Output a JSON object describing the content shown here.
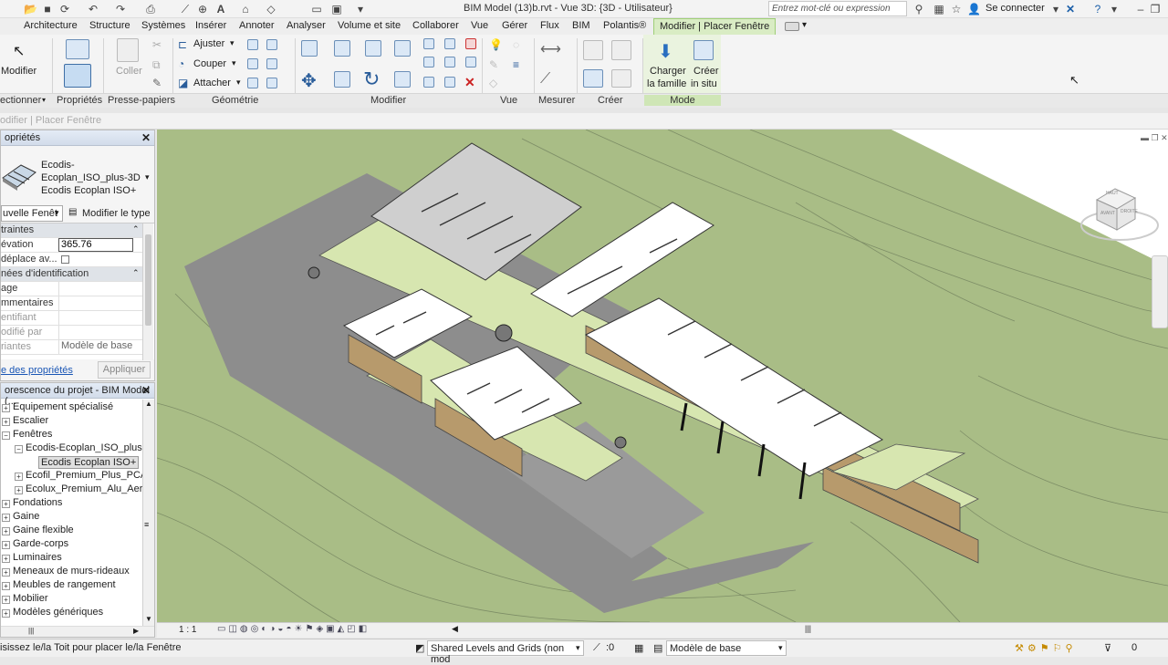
{
  "window": {
    "title": "BIM Model (13)b.rvt - Vue 3D: {3D - Utilisateur}",
    "search_placeholder": "Entrez mot-clé ou expression",
    "sign_in": "Se connecter"
  },
  "ribbon_tabs": [
    "Architecture",
    "Structure",
    "Systèmes",
    "Insérer",
    "Annoter",
    "Analyser",
    "Volume et site",
    "Collaborer",
    "Vue",
    "Gérer",
    "Flux",
    "BIM",
    "Polantis®",
    "Modifier | Placer Fenêtre"
  ],
  "ribbon": {
    "modify_label": "Modifier",
    "paste_label": "Coller",
    "adjust_label": "Ajuster",
    "cut_label": "Couper",
    "attach_label": "Attacher",
    "load_family_line1": "Charger",
    "load_family_line2": "la famille",
    "create_inplace_line1": "Créer",
    "create_inplace_line2": "in situ",
    "groups": {
      "select": "ectionner",
      "properties": "Propriétés",
      "clipboard": "Presse-papiers",
      "geometry": "Géométrie",
      "modify": "Modifier",
      "view": "Vue",
      "measure": "Mesurer",
      "create": "Créer",
      "mode": "Mode"
    }
  },
  "options_bar": "odifier | Placer Fenêtre",
  "properties_panel": {
    "title": "opriétés",
    "type_line1": "Ecodis-",
    "type_line2": "Ecoplan_ISO_plus-3D",
    "type_line3": "Ecodis Ecoplan ISO+",
    "filter_value": "uvelle Fenêt",
    "edit_type": "Modifier le type",
    "rows": [
      {
        "key": "traintes",
        "value": "",
        "section": true
      },
      {
        "key": "évation",
        "value": "365.76",
        "section": false
      },
      {
        "key": "déplace av...",
        "value": "",
        "section": false
      },
      {
        "key": "nées d'identification",
        "value": "",
        "section": true
      },
      {
        "key": "age",
        "value": "",
        "section": false
      },
      {
        "key": "mmentaires",
        "value": "",
        "section": false
      },
      {
        "key": "entifiant",
        "value": "",
        "section": false
      },
      {
        "key": "odifié par",
        "value": "",
        "section": false
      },
      {
        "key": "riantes",
        "value": "Modèle de base",
        "section": false
      }
    ],
    "help_link": "e des propriétés",
    "apply": "Appliquer"
  },
  "browser": {
    "title": "orescence du projet - BIM Model (...",
    "items": [
      {
        "label": "Equipement spécialisé",
        "level": 0,
        "toggle": "+"
      },
      {
        "label": "Escalier",
        "level": 0,
        "toggle": "+"
      },
      {
        "label": "Fenêtres",
        "level": 0,
        "toggle": "−"
      },
      {
        "label": "Ecodis-Ecoplan_ISO_plus-3D",
        "level": 1,
        "toggle": "−"
      },
      {
        "label": "Ecodis Ecoplan ISO+",
        "level": 2,
        "toggle": ""
      },
      {
        "label": "Ecofil_Premium_Plus_PCA_1(",
        "level": 1,
        "toggle": "+"
      },
      {
        "label": "Ecolux_Premium_Alu_Aerati",
        "level": 1,
        "toggle": "+"
      },
      {
        "label": "Fondations",
        "level": 0,
        "toggle": "+"
      },
      {
        "label": "Gaine",
        "level": 0,
        "toggle": "+"
      },
      {
        "label": "Gaine flexible",
        "level": 0,
        "toggle": "+"
      },
      {
        "label": "Garde-corps",
        "level": 0,
        "toggle": "+"
      },
      {
        "label": "Luminaires",
        "level": 0,
        "toggle": "+"
      },
      {
        "label": "Meneaux de murs-rideaux",
        "level": 0,
        "toggle": "+"
      },
      {
        "label": "Meubles de rangement",
        "level": 0,
        "toggle": "+"
      },
      {
        "label": "Mobilier",
        "level": 0,
        "toggle": "+"
      },
      {
        "label": "Modèles génériques",
        "level": 0,
        "toggle": "+"
      }
    ]
  },
  "viewbar": {
    "scale": "1 : 1"
  },
  "viewcube": {
    "top": "HAUT",
    "front": "AVANT",
    "right": "DROITE"
  },
  "status": {
    "message": "isissez le/la Toit pour placer le/la Fenêtre",
    "workset": "Shared Levels and Grids (non mod",
    "count": ":0",
    "design_option": "Modèle de base",
    "filter_count": "0"
  }
}
